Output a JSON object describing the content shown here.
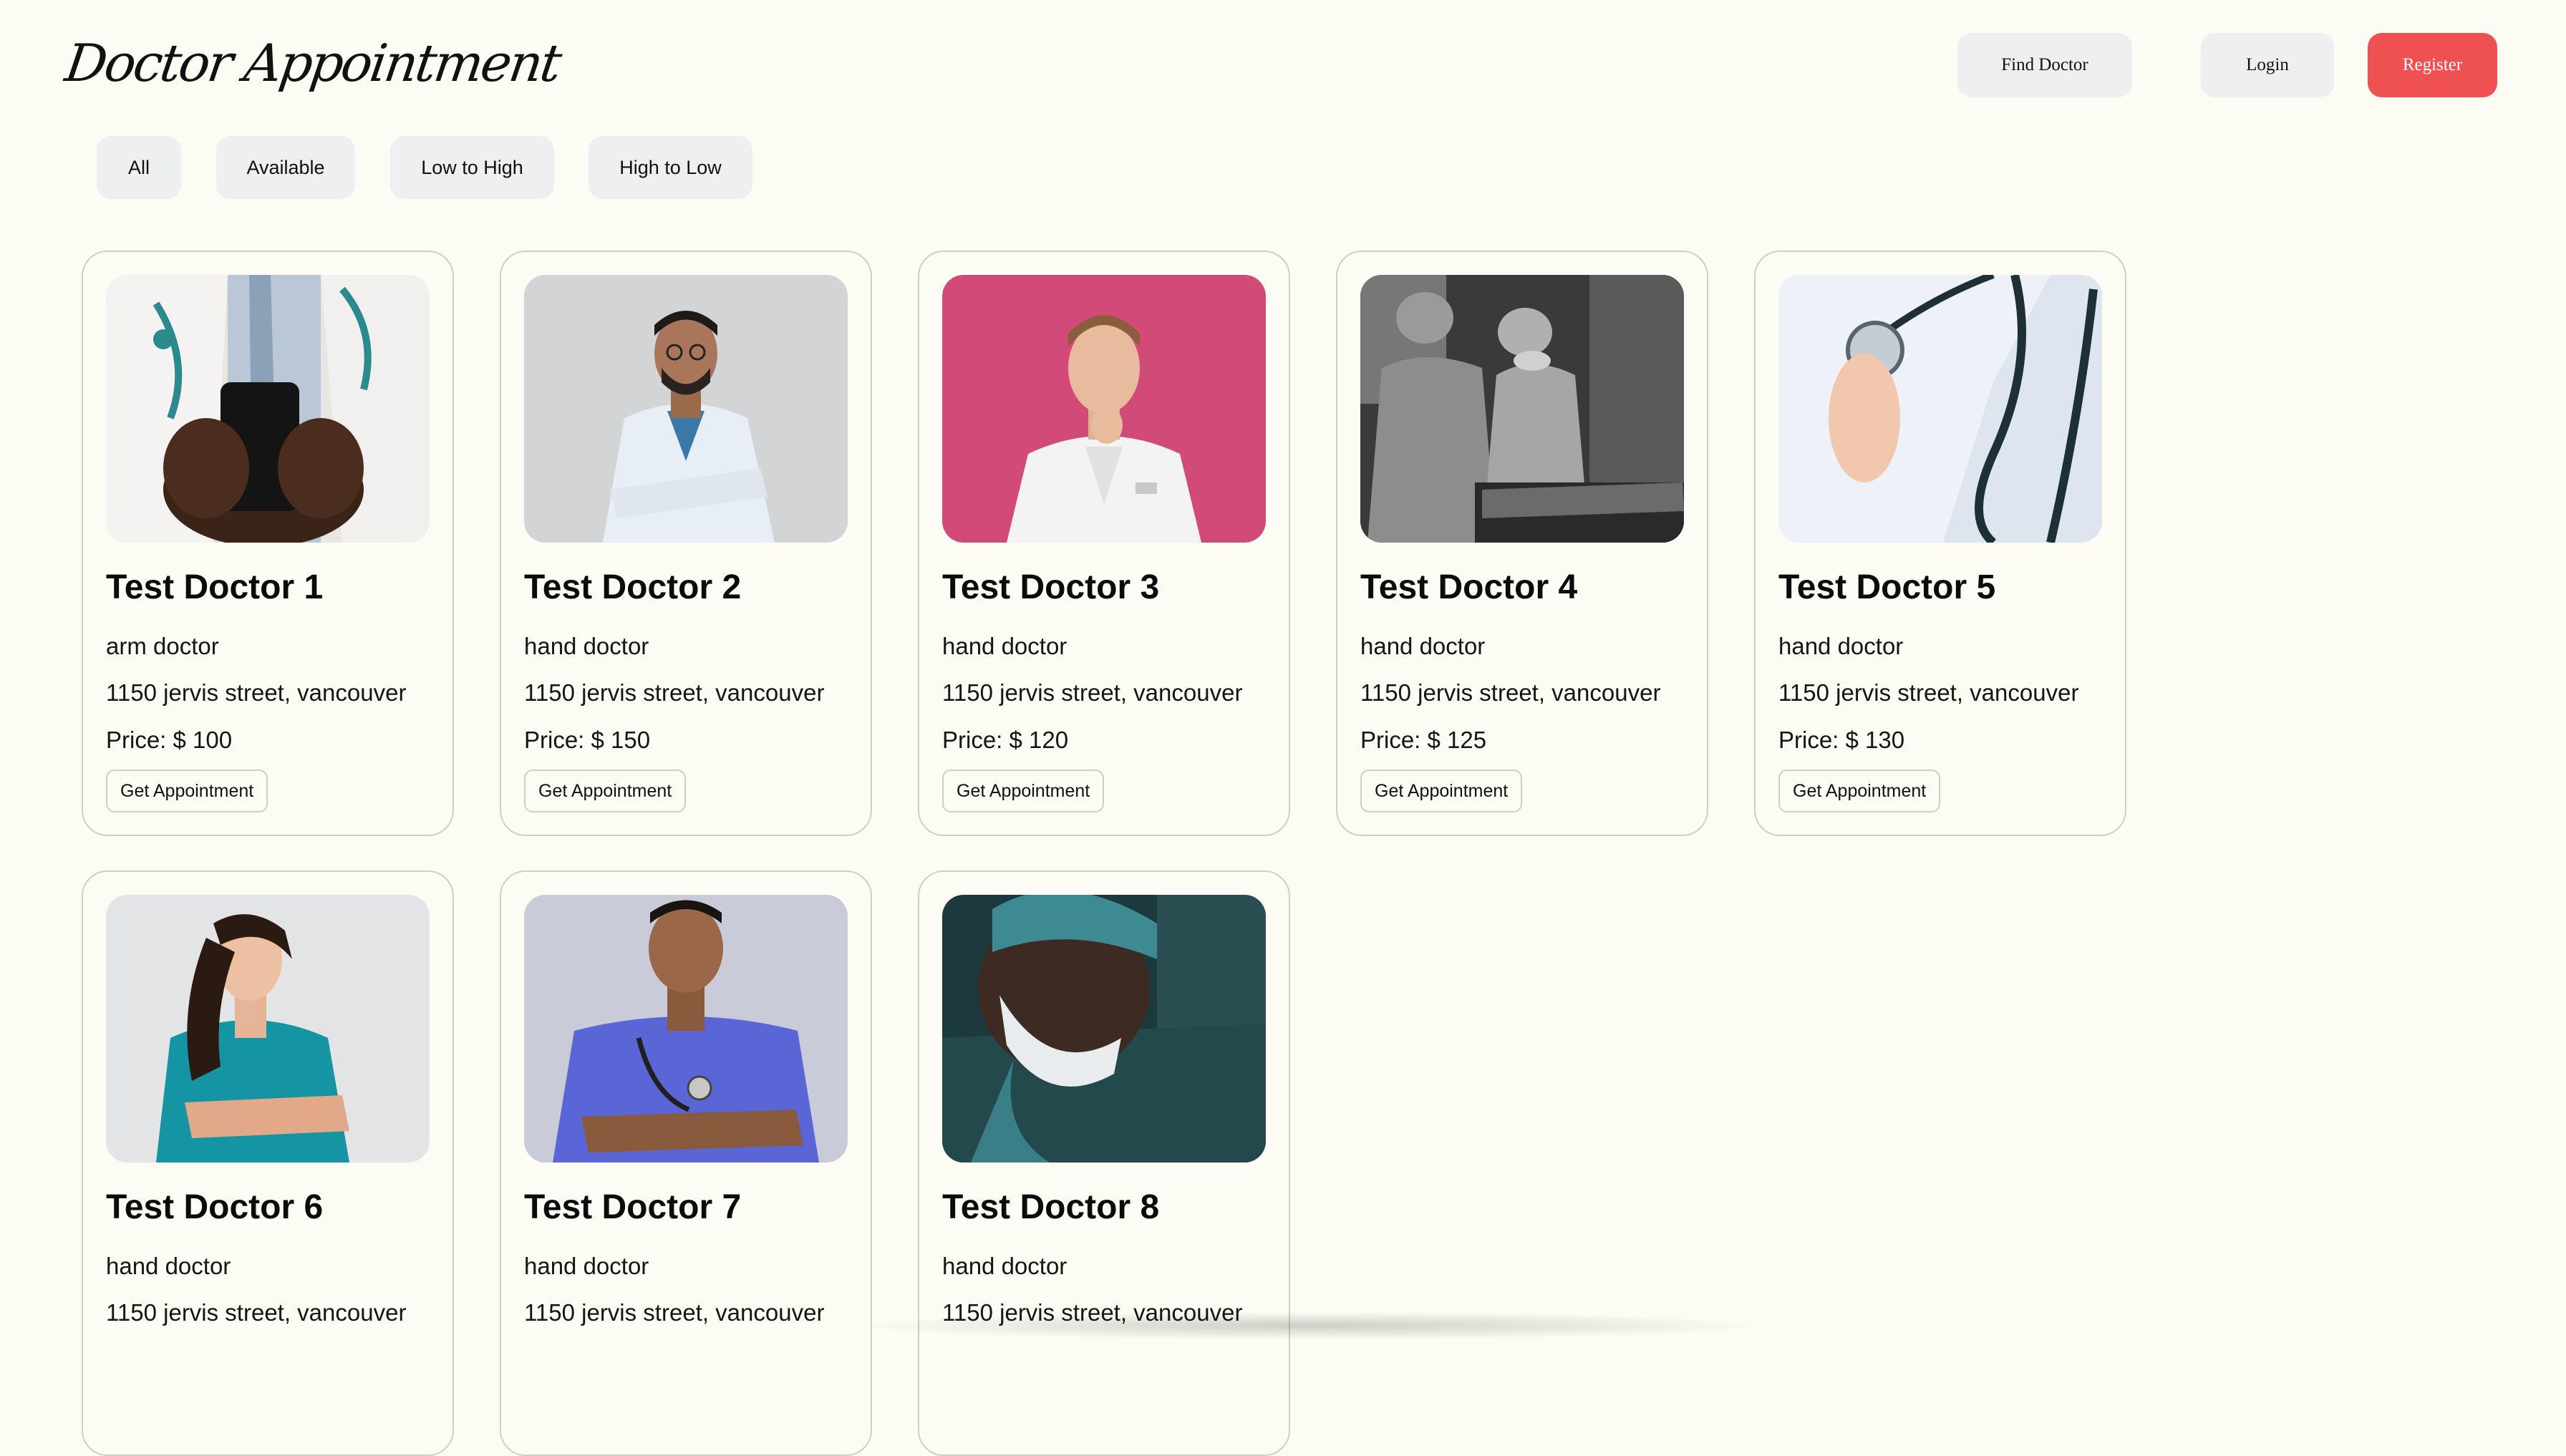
{
  "header": {
    "logo": "Doctor Appointment",
    "nav": {
      "find_doctor": "Find Doctor",
      "login": "Login",
      "register": "Register"
    },
    "register_color": "#ef5052"
  },
  "filters": [
    "All",
    "Available",
    "Low to High",
    "High to Low"
  ],
  "doctors": [
    {
      "name": "Test Doctor 1",
      "specialty": "arm doctor",
      "address": "1150 jervis street, vancouver",
      "price": "Price: $ 100",
      "button": "Get Appointment",
      "photo": "doctor-with-phone-photo"
    },
    {
      "name": "Test Doctor 2",
      "specialty": "hand doctor",
      "address": "1150 jervis street, vancouver",
      "price": "Price: $ 150",
      "button": "Get Appointment",
      "photo": "doctor-arms-crossed-photo"
    },
    {
      "name": "Test Doctor 3",
      "specialty": "hand doctor",
      "address": "1150 jervis street, vancouver",
      "price": "Price: $ 120",
      "button": "Get Appointment",
      "photo": "doctor-pink-background-photo"
    },
    {
      "name": "Test Doctor 4",
      "specialty": "hand doctor",
      "address": "1150 jervis street, vancouver",
      "price": "Price: $ 125",
      "button": "Get Appointment",
      "photo": "surgeons-operating-room-photo"
    },
    {
      "name": "Test Doctor 5",
      "specialty": "hand doctor",
      "address": "1150 jervis street, vancouver",
      "price": "Price: $ 130",
      "button": "Get Appointment",
      "photo": "stethoscope-closeup-photo"
    },
    {
      "name": "Test Doctor 6",
      "specialty": "hand doctor",
      "address": "1150 jervis street, vancouver",
      "photo": "doctor-teal-scrubs-photo"
    },
    {
      "name": "Test Doctor 7",
      "specialty": "hand doctor",
      "address": "1150 jervis street, vancouver",
      "photo": "doctor-blue-scrubs-photo"
    },
    {
      "name": "Test Doctor 8",
      "specialty": "hand doctor",
      "address": "1150 jervis street, vancouver",
      "photo": "surgeon-masked-photo"
    }
  ]
}
